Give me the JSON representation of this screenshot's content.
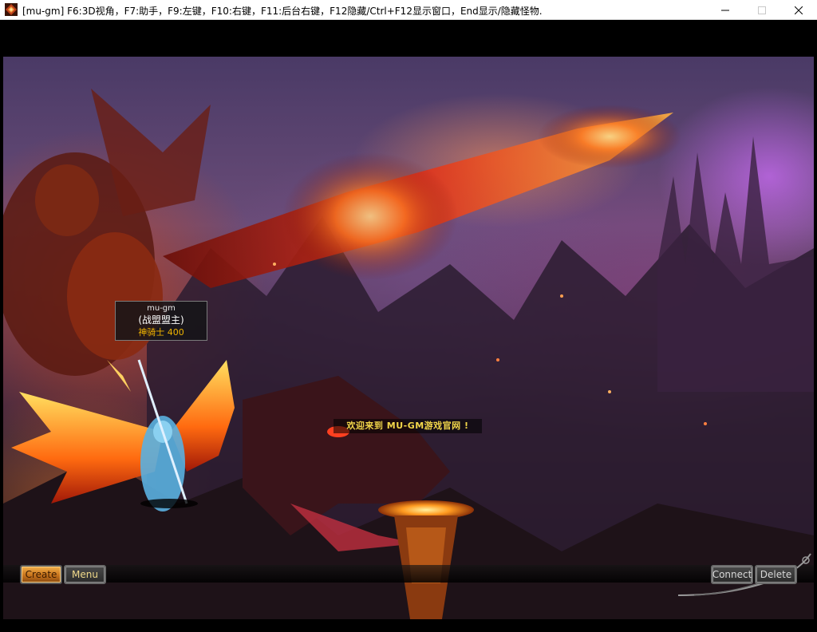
{
  "window": {
    "title": "[mu-gm] F6:3D视角，F7:助手，F9:左键，F10:右键，F11:后台右键，F12隐藏/Ctrl+F12显示窗口，End显示/隐藏怪物.",
    "icons": {
      "app": "game-app-icon",
      "minimize": "minimize-icon",
      "maximize": "maximize-icon",
      "close": "close-icon"
    }
  },
  "character": {
    "name": "mu-gm",
    "guild": "(战盟盟主)",
    "class_level": "神骑士  400"
  },
  "banner": {
    "welcome": "欢迎来到 MU-GM游戏官网 !"
  },
  "buttons": {
    "create": "Create",
    "menu": "Menu",
    "connect": "Connect",
    "delete": "Delete"
  },
  "colors": {
    "guild_text": "#ffffff",
    "class_text": "#f0b400",
    "welcome_text": "#f2d64a",
    "create_button": "#e09030"
  }
}
